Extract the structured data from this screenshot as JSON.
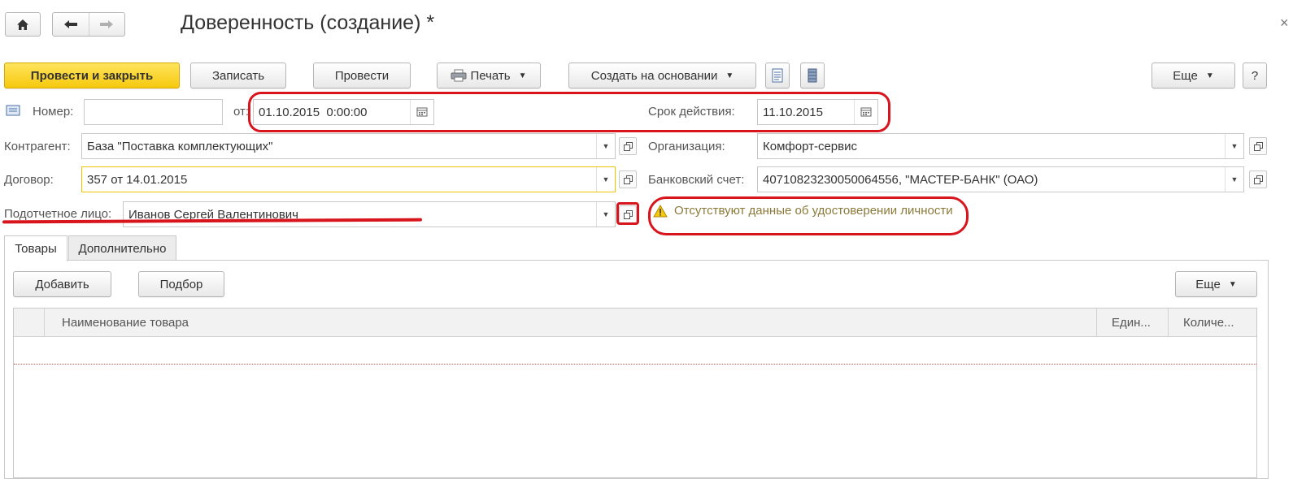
{
  "window": {
    "title": "Доверенность (создание) *",
    "home_icon": "home-icon",
    "back_icon": "arrow-left-icon",
    "forward_icon": "arrow-right-icon",
    "close_icon": "close-icon"
  },
  "toolbar": {
    "post_and_close": "Провести и закрыть",
    "save": "Записать",
    "post": "Провести",
    "print": "Печать",
    "create_based_on": "Создать на основании",
    "more": "Еще",
    "help": "?"
  },
  "form": {
    "number_label": "Номер:",
    "number_value": "",
    "date_label": "от:",
    "date_value": "01.10.2015  0:00:00",
    "valid_until_label": "Срок действия:",
    "valid_until_value": "11.10.2015",
    "counterparty_label": "Контрагент:",
    "counterparty_value": "База \"Поставка комплектующих\"",
    "organization_label": "Организация:",
    "organization_value": "Комфорт-сервис",
    "contract_label": "Договор:",
    "contract_value": "357 от 14.01.2015",
    "bank_account_label": "Банковский счет:",
    "bank_account_value": "40710823230050064556, \"МАСТЕР-БАНК\" (ОАО)",
    "accountable_label": "Подотчетное лицо:",
    "accountable_value": "Иванов Сергей Валентинович",
    "warning": "Отсутствуют данные об удостоверении личности"
  },
  "tabs": [
    {
      "label": "Товары",
      "active": true
    },
    {
      "label": "Дополнительно",
      "active": false
    }
  ],
  "goods": {
    "add": "Добавить",
    "select": "Подбор",
    "more": "Еще",
    "columns": [
      "Наименование товара",
      "Един...",
      "Количе..."
    ],
    "rows": []
  },
  "colors": {
    "accent_yellow": "#f6c90e",
    "annotation_red": "#d8141c",
    "warning_text": "#8a7a3a"
  }
}
